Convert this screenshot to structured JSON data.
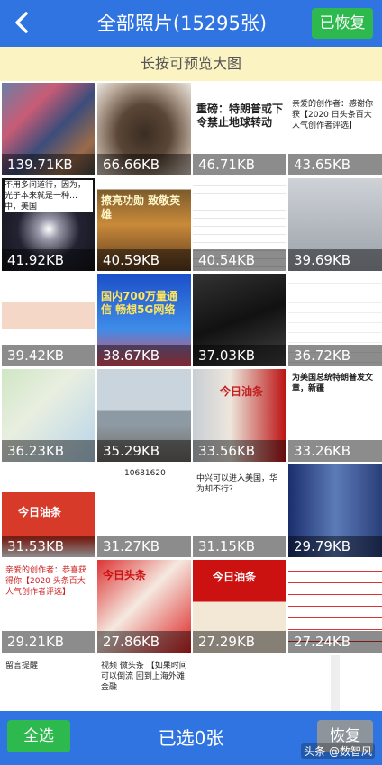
{
  "header": {
    "title": "全部照片(15295张)",
    "restored_label": "已恢复"
  },
  "hint": "长按可预览大图",
  "photos": [
    {
      "size": "139.71KB"
    },
    {
      "size": "66.66KB"
    },
    {
      "size": "46.71KB",
      "text": "重磅：特朗普或下令禁止地球转动"
    },
    {
      "size": "43.65KB",
      "text": "亲爱的创作者：感谢你获【2020 日头条百大人气创作者评选】"
    },
    {
      "size": "41.92KB",
      "text": "不用多问道行，因为，光子本来就是一种… 中，美国"
    },
    {
      "size": "40.59KB",
      "text": "擦亮功勋 致敬英雄"
    },
    {
      "size": "40.54KB"
    },
    {
      "size": "39.69KB"
    },
    {
      "size": "39.42KB"
    },
    {
      "size": "38.67KB",
      "text": "国内700万量通信 畅想5G网络"
    },
    {
      "size": "37.03KB"
    },
    {
      "size": "36.72KB"
    },
    {
      "size": "36.23KB"
    },
    {
      "size": "35.29KB"
    },
    {
      "size": "33.56KB",
      "text": "今日油条"
    },
    {
      "size": "33.26KB",
      "text": "为美国总统特朗普发文章，新疆"
    },
    {
      "size": "31.53KB",
      "text": "今日油条"
    },
    {
      "size": "31.27KB",
      "text": "10681620"
    },
    {
      "size": "31.15KB",
      "text": "中兴可以进入美国，华为却不行？"
    },
    {
      "size": "29.79KB"
    },
    {
      "size": "29.21KB",
      "text": "亲爱的创作者：恭喜获得你【2020 头条百大人气创作者评选】"
    },
    {
      "size": "27.86KB",
      "text": "今日头条"
    },
    {
      "size": "27.29KB",
      "text": "今日油条"
    },
    {
      "size": "27.24KB"
    },
    {
      "size": "",
      "text": "留言提醒"
    },
    {
      "size": "",
      "text": "视频 微头条 【如果时间可以倒流 回到上海外滩金融"
    },
    {
      "size": ""
    },
    {
      "size": ""
    }
  ],
  "footer": {
    "select_all_label": "全选",
    "selected_count": "已选0张",
    "restore_label": "恢复",
    "watermark": "头条 @数智风"
  },
  "colors": {
    "header_bg": "#2f74e0",
    "green": "#2eb94e",
    "hint_bg": "#fbf3c2"
  }
}
